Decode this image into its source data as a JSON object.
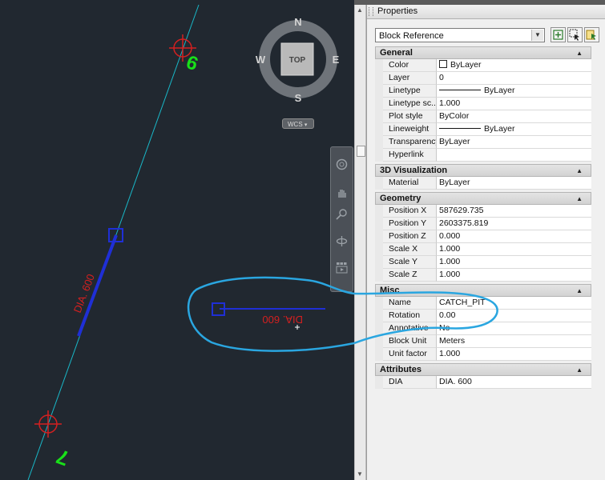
{
  "canvas": {
    "viewcube": {
      "north": "N",
      "south": "S",
      "east": "E",
      "west": "W",
      "face": "TOP"
    },
    "wcs_label": "WCS",
    "pipe_label": "DIA. 600",
    "block_label": "DIA. 600",
    "node_top": "9",
    "node_bottom": "7",
    "colors": {
      "background": "#212830",
      "pipe": "#1f2fd6",
      "text": "#d42020",
      "node": "#19e019",
      "alignment": "#19b8c8",
      "annotation": "#2aa6e0"
    }
  },
  "navbar": {
    "icons": [
      "steering-wheel-icon",
      "pan-icon",
      "zoom-icon",
      "orbit-icon",
      "showmotion-icon"
    ]
  },
  "palette": {
    "title": "Properties",
    "selector_value": "Block Reference",
    "toolbar_icons": [
      "toggle-pickadd-icon",
      "select-objects-icon",
      "quick-select-icon"
    ],
    "sections": [
      {
        "name": "General",
        "rows": [
          {
            "key": "Color",
            "value": "ByLayer",
            "swatch": true
          },
          {
            "key": "Layer",
            "value": "0"
          },
          {
            "key": "Linetype",
            "value": "ByLayer",
            "line": true
          },
          {
            "key": "Linetype sc...",
            "value": "1.000"
          },
          {
            "key": "Plot style",
            "value": "ByColor"
          },
          {
            "key": "Lineweight",
            "value": "ByLayer",
            "line": true
          },
          {
            "key": "Transparency",
            "value": "ByLayer"
          },
          {
            "key": "Hyperlink",
            "value": ""
          }
        ]
      },
      {
        "name": "3D Visualization",
        "rows": [
          {
            "key": "Material",
            "value": "ByLayer"
          }
        ]
      },
      {
        "name": "Geometry",
        "rows": [
          {
            "key": "Position X",
            "value": "587629.735"
          },
          {
            "key": "Position Y",
            "value": "2603375.819"
          },
          {
            "key": "Position Z",
            "value": "0.000"
          },
          {
            "key": "Scale X",
            "value": "1.000"
          },
          {
            "key": "Scale Y",
            "value": "1.000"
          },
          {
            "key": "Scale Z",
            "value": "1.000"
          }
        ]
      },
      {
        "name": "Misc",
        "rows": [
          {
            "key": "Name",
            "value": "CATCH_PIT"
          },
          {
            "key": "Rotation",
            "value": "0.00"
          },
          {
            "key": "Annotative",
            "value": "No"
          },
          {
            "key": "Block Unit",
            "value": "Meters"
          },
          {
            "key": "Unit factor",
            "value": "1.000"
          }
        ]
      },
      {
        "name": "Attributes",
        "rows": [
          {
            "key": "DIA",
            "value": "DIA. 600"
          }
        ]
      }
    ]
  }
}
